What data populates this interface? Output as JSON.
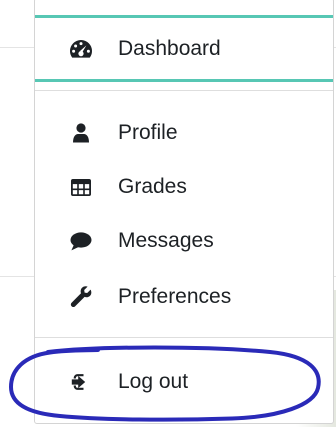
{
  "user_menu": {
    "items": [
      {
        "label": "Dashboard",
        "icon": "dashboard-icon"
      },
      {
        "label": "Profile",
        "icon": "user-icon"
      },
      {
        "label": "Grades",
        "icon": "table-icon"
      },
      {
        "label": "Messages",
        "icon": "comment-icon"
      },
      {
        "label": "Preferences",
        "icon": "wrench-icon"
      },
      {
        "label": "Log out",
        "icon": "sign-out-icon"
      }
    ],
    "active_item": "Dashboard",
    "accent_color": "#57c7b4",
    "annotation_color": "#2a2ab8"
  }
}
